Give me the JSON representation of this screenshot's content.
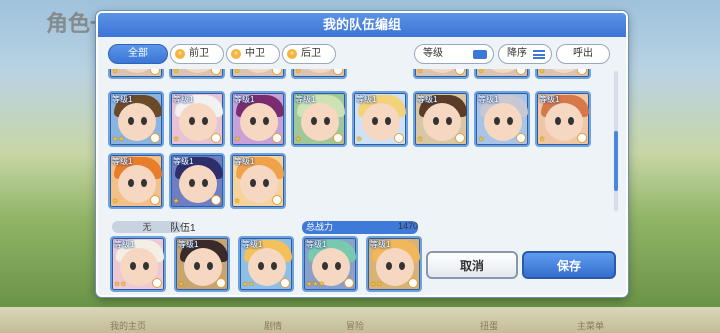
{
  "background": {
    "title_text": "角色一览",
    "bottom_tabs": [
      "我的主页",
      "剧情",
      "冒险",
      "扭蛋",
      "主菜单"
    ]
  },
  "dialog": {
    "title": "我的队伍编组"
  },
  "filters": {
    "tabs": [
      {
        "label": "全部",
        "active": true
      },
      {
        "label": "前卫",
        "active": false
      },
      {
        "label": "中卫",
        "active": false
      },
      {
        "label": "后卫",
        "active": false
      }
    ],
    "sort_label": "等级",
    "order_label": "降序",
    "exit_label": "呼出"
  },
  "roster": {
    "level_label": "等级1",
    "cards": [
      {
        "row": 1,
        "col": 0,
        "hair": "#6b4a2a",
        "skin": "#f6d7c2",
        "bg": "#8bb5df",
        "stars": 2
      },
      {
        "row": 1,
        "col": 1,
        "hair": "#f2f2f2",
        "skin": "#f6d7c2",
        "bg": "#e8c3d6",
        "stars": 1
      },
      {
        "row": 1,
        "col": 2,
        "hair": "#7a2d6e",
        "skin": "#f6d7c2",
        "bg": "#c9a1d9",
        "stars": 1
      },
      {
        "row": 1,
        "col": 3,
        "hair": "#cde3b4",
        "skin": "#f6d7c2",
        "bg": "#9fc79a",
        "stars": 1
      },
      {
        "row": 1,
        "col": 4,
        "hair": "#f2d27a",
        "skin": "#f6d7c2",
        "bg": "#cfe1f4",
        "stars": 1
      },
      {
        "row": 1,
        "col": 5,
        "hair": "#5a3c28",
        "skin": "#f6d7c2",
        "bg": "#d8c7a5",
        "stars": 1
      },
      {
        "row": 1,
        "col": 6,
        "hair": "#c8c8d4",
        "skin": "#f6d7c2",
        "bg": "#a9c4e4",
        "stars": 1
      },
      {
        "row": 1,
        "col": 7,
        "hair": "#d7784a",
        "skin": "#f6d7c2",
        "bg": "#f0c7a5",
        "stars": 1
      },
      {
        "row": 2,
        "col": 0,
        "hair": "#e87d2a",
        "skin": "#f6d7c2",
        "bg": "#f3c08a",
        "stars": 1
      },
      {
        "row": 2,
        "col": 1,
        "hair": "#2e2f6a",
        "skin": "#f6d7c2",
        "bg": "#6f7ec2",
        "stars": 1
      },
      {
        "row": 2,
        "col": 2,
        "hair": "#f0a24a",
        "skin": "#f6d7c2",
        "bg": "#f6d39a",
        "stars": 1
      }
    ]
  },
  "party": {
    "slot_label": "无",
    "name": "队伍1",
    "power_label": "总战力",
    "power_value": "1470",
    "members": [
      {
        "hair": "#f3efe4",
        "skin": "#f6d7c2",
        "bg": "#eec9d4",
        "stars": 2,
        "level": "等级1"
      },
      {
        "hair": "#3a2a2a",
        "skin": "#f6d7c2",
        "bg": "#c8a46e",
        "stars": 1,
        "level": "等级1"
      },
      {
        "hair": "#f2c15a",
        "skin": "#f6d7c2",
        "bg": "#8ec0e6",
        "stars": 2,
        "level": "等级1"
      },
      {
        "hair": "#79c9b0",
        "skin": "#f6d7c2",
        "bg": "#8aa0c8",
        "stars": 3,
        "level": "等级1"
      },
      {
        "hair": "#f0b85a",
        "skin": "#f6d7c2",
        "bg": "#d8b277",
        "stars": 2,
        "level": "等级1"
      }
    ]
  },
  "buttons": {
    "cancel": "取消",
    "save": "保存"
  }
}
